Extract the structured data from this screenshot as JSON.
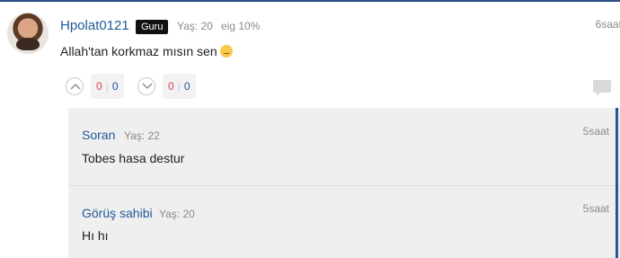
{
  "comment": {
    "username": "Hpolat0121",
    "badge": "Guru",
    "age": "Yaş: 20",
    "eig": "eig 10%",
    "time": "6saat",
    "text": "Allah'tan korkmaz mısın sen",
    "emoji": "unamused-face",
    "upvotes_pos": "0",
    "upvotes_neg": "0",
    "downvotes_pos": "0",
    "downvotes_neg": "0"
  },
  "replies": [
    {
      "username": "Soran",
      "age": "Yaş: 22",
      "time": "5saat",
      "text": "Tobes hasa destur"
    },
    {
      "username": "Görüş sahibi",
      "age": "Yaş: 20",
      "time": "5saat",
      "text": "Hı hı"
    }
  ],
  "icons": {
    "upvote": "chevron-up-icon",
    "downvote": "chevron-down-icon",
    "reply": "speech-bubble-icon"
  },
  "colors": {
    "link": "#1f5a96",
    "positive": "#e0405a",
    "badge_bg": "#111111",
    "reply_bg": "#efefef"
  }
}
